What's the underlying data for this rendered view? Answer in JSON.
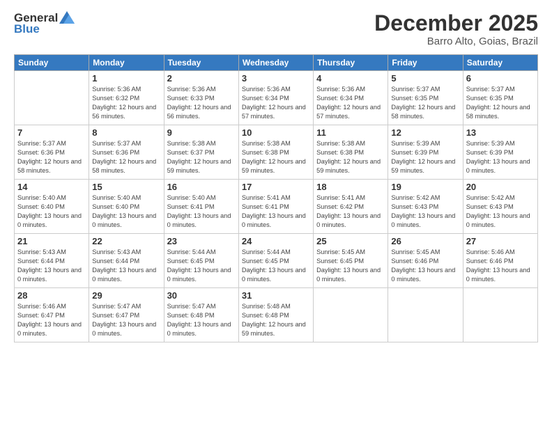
{
  "logo": {
    "general": "General",
    "blue": "Blue"
  },
  "header": {
    "month": "December 2025",
    "location": "Barro Alto, Goias, Brazil"
  },
  "weekdays": [
    "Sunday",
    "Monday",
    "Tuesday",
    "Wednesday",
    "Thursday",
    "Friday",
    "Saturday"
  ],
  "weeks": [
    [
      {
        "day": "",
        "sunrise": "",
        "sunset": "",
        "daylight": ""
      },
      {
        "day": "1",
        "sunrise": "Sunrise: 5:36 AM",
        "sunset": "Sunset: 6:32 PM",
        "daylight": "Daylight: 12 hours and 56 minutes."
      },
      {
        "day": "2",
        "sunrise": "Sunrise: 5:36 AM",
        "sunset": "Sunset: 6:33 PM",
        "daylight": "Daylight: 12 hours and 56 minutes."
      },
      {
        "day": "3",
        "sunrise": "Sunrise: 5:36 AM",
        "sunset": "Sunset: 6:34 PM",
        "daylight": "Daylight: 12 hours and 57 minutes."
      },
      {
        "day": "4",
        "sunrise": "Sunrise: 5:36 AM",
        "sunset": "Sunset: 6:34 PM",
        "daylight": "Daylight: 12 hours and 57 minutes."
      },
      {
        "day": "5",
        "sunrise": "Sunrise: 5:37 AM",
        "sunset": "Sunset: 6:35 PM",
        "daylight": "Daylight: 12 hours and 58 minutes."
      },
      {
        "day": "6",
        "sunrise": "Sunrise: 5:37 AM",
        "sunset": "Sunset: 6:35 PM",
        "daylight": "Daylight: 12 hours and 58 minutes."
      }
    ],
    [
      {
        "day": "7",
        "sunrise": "Sunrise: 5:37 AM",
        "sunset": "Sunset: 6:36 PM",
        "daylight": "Daylight: 12 hours and 58 minutes."
      },
      {
        "day": "8",
        "sunrise": "Sunrise: 5:37 AM",
        "sunset": "Sunset: 6:36 PM",
        "daylight": "Daylight: 12 hours and 58 minutes."
      },
      {
        "day": "9",
        "sunrise": "Sunrise: 5:38 AM",
        "sunset": "Sunset: 6:37 PM",
        "daylight": "Daylight: 12 hours and 59 minutes."
      },
      {
        "day": "10",
        "sunrise": "Sunrise: 5:38 AM",
        "sunset": "Sunset: 6:38 PM",
        "daylight": "Daylight: 12 hours and 59 minutes."
      },
      {
        "day": "11",
        "sunrise": "Sunrise: 5:38 AM",
        "sunset": "Sunset: 6:38 PM",
        "daylight": "Daylight: 12 hours and 59 minutes."
      },
      {
        "day": "12",
        "sunrise": "Sunrise: 5:39 AM",
        "sunset": "Sunset: 6:39 PM",
        "daylight": "Daylight: 12 hours and 59 minutes."
      },
      {
        "day": "13",
        "sunrise": "Sunrise: 5:39 AM",
        "sunset": "Sunset: 6:39 PM",
        "daylight": "Daylight: 13 hours and 0 minutes."
      }
    ],
    [
      {
        "day": "14",
        "sunrise": "Sunrise: 5:40 AM",
        "sunset": "Sunset: 6:40 PM",
        "daylight": "Daylight: 13 hours and 0 minutes."
      },
      {
        "day": "15",
        "sunrise": "Sunrise: 5:40 AM",
        "sunset": "Sunset: 6:40 PM",
        "daylight": "Daylight: 13 hours and 0 minutes."
      },
      {
        "day": "16",
        "sunrise": "Sunrise: 5:40 AM",
        "sunset": "Sunset: 6:41 PM",
        "daylight": "Daylight: 13 hours and 0 minutes."
      },
      {
        "day": "17",
        "sunrise": "Sunrise: 5:41 AM",
        "sunset": "Sunset: 6:41 PM",
        "daylight": "Daylight: 13 hours and 0 minutes."
      },
      {
        "day": "18",
        "sunrise": "Sunrise: 5:41 AM",
        "sunset": "Sunset: 6:42 PM",
        "daylight": "Daylight: 13 hours and 0 minutes."
      },
      {
        "day": "19",
        "sunrise": "Sunrise: 5:42 AM",
        "sunset": "Sunset: 6:43 PM",
        "daylight": "Daylight: 13 hours and 0 minutes."
      },
      {
        "day": "20",
        "sunrise": "Sunrise: 5:42 AM",
        "sunset": "Sunset: 6:43 PM",
        "daylight": "Daylight: 13 hours and 0 minutes."
      }
    ],
    [
      {
        "day": "21",
        "sunrise": "Sunrise: 5:43 AM",
        "sunset": "Sunset: 6:44 PM",
        "daylight": "Daylight: 13 hours and 0 minutes."
      },
      {
        "day": "22",
        "sunrise": "Sunrise: 5:43 AM",
        "sunset": "Sunset: 6:44 PM",
        "daylight": "Daylight: 13 hours and 0 minutes."
      },
      {
        "day": "23",
        "sunrise": "Sunrise: 5:44 AM",
        "sunset": "Sunset: 6:45 PM",
        "daylight": "Daylight: 13 hours and 0 minutes."
      },
      {
        "day": "24",
        "sunrise": "Sunrise: 5:44 AM",
        "sunset": "Sunset: 6:45 PM",
        "daylight": "Daylight: 13 hours and 0 minutes."
      },
      {
        "day": "25",
        "sunrise": "Sunrise: 5:45 AM",
        "sunset": "Sunset: 6:45 PM",
        "daylight": "Daylight: 13 hours and 0 minutes."
      },
      {
        "day": "26",
        "sunrise": "Sunrise: 5:45 AM",
        "sunset": "Sunset: 6:46 PM",
        "daylight": "Daylight: 13 hours and 0 minutes."
      },
      {
        "day": "27",
        "sunrise": "Sunrise: 5:46 AM",
        "sunset": "Sunset: 6:46 PM",
        "daylight": "Daylight: 13 hours and 0 minutes."
      }
    ],
    [
      {
        "day": "28",
        "sunrise": "Sunrise: 5:46 AM",
        "sunset": "Sunset: 6:47 PM",
        "daylight": "Daylight: 13 hours and 0 minutes."
      },
      {
        "day": "29",
        "sunrise": "Sunrise: 5:47 AM",
        "sunset": "Sunset: 6:47 PM",
        "daylight": "Daylight: 13 hours and 0 minutes."
      },
      {
        "day": "30",
        "sunrise": "Sunrise: 5:47 AM",
        "sunset": "Sunset: 6:48 PM",
        "daylight": "Daylight: 13 hours and 0 minutes."
      },
      {
        "day": "31",
        "sunrise": "Sunrise: 5:48 AM",
        "sunset": "Sunset: 6:48 PM",
        "daylight": "Daylight: 12 hours and 59 minutes."
      },
      {
        "day": "",
        "sunrise": "",
        "sunset": "",
        "daylight": ""
      },
      {
        "day": "",
        "sunrise": "",
        "sunset": "",
        "daylight": ""
      },
      {
        "day": "",
        "sunrise": "",
        "sunset": "",
        "daylight": ""
      }
    ]
  ]
}
